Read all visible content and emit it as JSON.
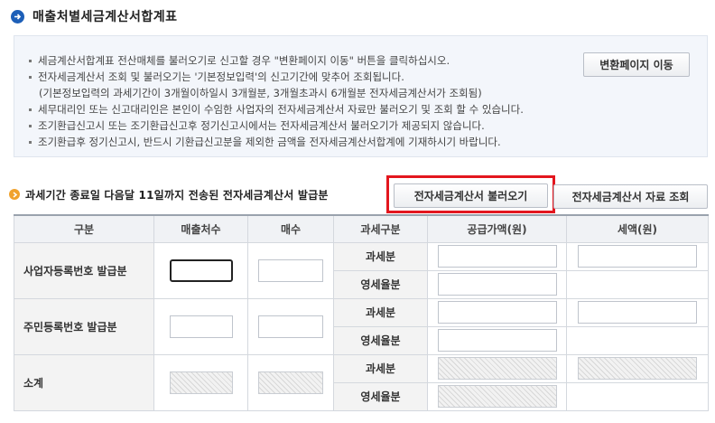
{
  "page": {
    "title": "매출처별세금계산서합계표"
  },
  "notice": {
    "lines": [
      "세금계산서합계표 전산매체를 불러오기로 신고할 경우 \"변환페이지 이동\" 버튼을 클릭하십시오.",
      "전자세금계산서 조회 및 불러오기는 '기본정보입력'의 신고기간에 맞추어 조회됩니다.",
      "(기본정보입력의 과세기간이 3개월이하일시 3개월분, 3개월초과시 6개월분 전자세금계산서가 조회됨)",
      "세무대리인 또는 신고대리인은 본인이 수임한 사업자의 전자세금계산서 자료만 불러오기 및 조회 할 수 있습니다.",
      "조기환급신고시 또는 조기환급신고후 정기신고시에서는 전자세금계산서 불러오기가 제공되지 않습니다.",
      "조기환급후 정기신고시, 반드시 기환급신고분을 제외한 금액을 전자세금계산서합계에 기재하시기 바랍니다."
    ],
    "convert_button": "변환페이지 이동"
  },
  "section": {
    "title": "과세기간 종료일 다음달 11일까지 전송된 전자세금계산서 발급분",
    "load_button": "전자세금계산서 불러오기",
    "view_button": "전자세금계산서 자료 조회"
  },
  "table": {
    "headers": [
      "구분",
      "매출처수",
      "매수",
      "과세구분",
      "공급가액(원)",
      "세액(원)"
    ],
    "groups": [
      {
        "label": "사업자등록번호 발급분",
        "sub": [
          "과세분",
          "영세율분"
        ]
      },
      {
        "label": "주민등록번호 발급분",
        "sub": [
          "과세분",
          "영세율분"
        ]
      },
      {
        "label": "소계",
        "sub": [
          "과세분",
          "영세율분"
        ]
      }
    ]
  },
  "colors": {
    "title_bullet": "#1d5fb8",
    "section_bullet": "#f0a22e",
    "highlight_border": "#e3161e",
    "notice_bg": "#f3f6fb"
  }
}
